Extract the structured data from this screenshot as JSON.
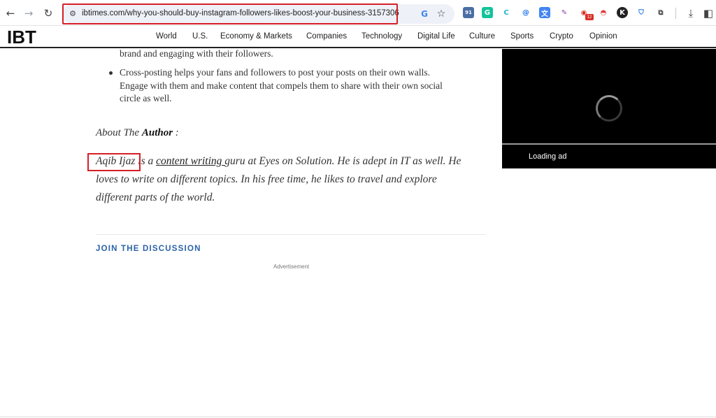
{
  "browser": {
    "url": "ibtimes.com/why-you-should-buy-instagram-followers-likes-boost-your-business-3157306",
    "icons": {
      "back": "←",
      "forward": "→",
      "reload": "↻",
      "site_info": "⚙",
      "google": "G",
      "bookmark": "☆",
      "download": "⤓",
      "side_panel": "◧"
    },
    "extensions": [
      {
        "name": "ext-91",
        "glyph": "91",
        "color": "#ffffff",
        "bg": "#4a6fa5"
      },
      {
        "name": "grammarly",
        "glyph": "G",
        "color": "#ffffff",
        "bg": "#15c39a"
      },
      {
        "name": "ext-c",
        "glyph": "C",
        "color": "#23b5d3",
        "bg": "#ffffff"
      },
      {
        "name": "ext-at",
        "glyph": "@",
        "color": "#1a73e8",
        "bg": "#ffffff"
      },
      {
        "name": "translate",
        "glyph": "文",
        "color": "#ffffff",
        "bg": "#4285f4"
      },
      {
        "name": "pen",
        "glyph": "✎",
        "color": "#8e44ad",
        "bg": "#ffffff"
      },
      {
        "name": "ext-badge-red",
        "glyph": "◉",
        "color": "#d93025",
        "bg": "#ffffff"
      },
      {
        "name": "pokeball",
        "glyph": "◓",
        "color": "#e53935",
        "bg": "#ffffff"
      },
      {
        "name": "ext-k",
        "glyph": "K",
        "color": "#ffffff",
        "bg": "#222222"
      },
      {
        "name": "shield",
        "glyph": "⛉",
        "color": "#1a73e8",
        "bg": "#ffffff"
      },
      {
        "name": "puzzle",
        "glyph": "⧉",
        "color": "#444444",
        "bg": "#ffffff"
      }
    ],
    "ext_badge": "12"
  },
  "site": {
    "logo": "IBT",
    "nav": [
      "World",
      "U.S.",
      "Economy & Markets",
      "Companies",
      "Technology",
      "Digital Life",
      "Culture",
      "Sports",
      "Crypto",
      "Opinion"
    ]
  },
  "article": {
    "bullet_continued": "brand and engaging with their followers.",
    "bullet2_lines": [
      "Cross-posting helps your fans and followers to post your posts on their own walls.",
      "Engage with them and make content that compels them to share with their own social",
      "circle as well."
    ],
    "about_prefix": "About The ",
    "about_bold": "Author",
    "about_suffix": " :",
    "author_name": "Aqib Ijaz",
    "author_text1": " is a ",
    "author_link": "content writing ",
    "author_text2": "guru at Eyes on Solution. He is adept in IT as well. He",
    "author_line2": "loves to write on different topics. In his free time, he likes to travel and explore",
    "author_line3": "different parts of the world.",
    "discussion": "JOIN THE DISCUSSION",
    "advertisement": "Advertisement"
  },
  "ad": {
    "loading_text": "Loading ad"
  }
}
